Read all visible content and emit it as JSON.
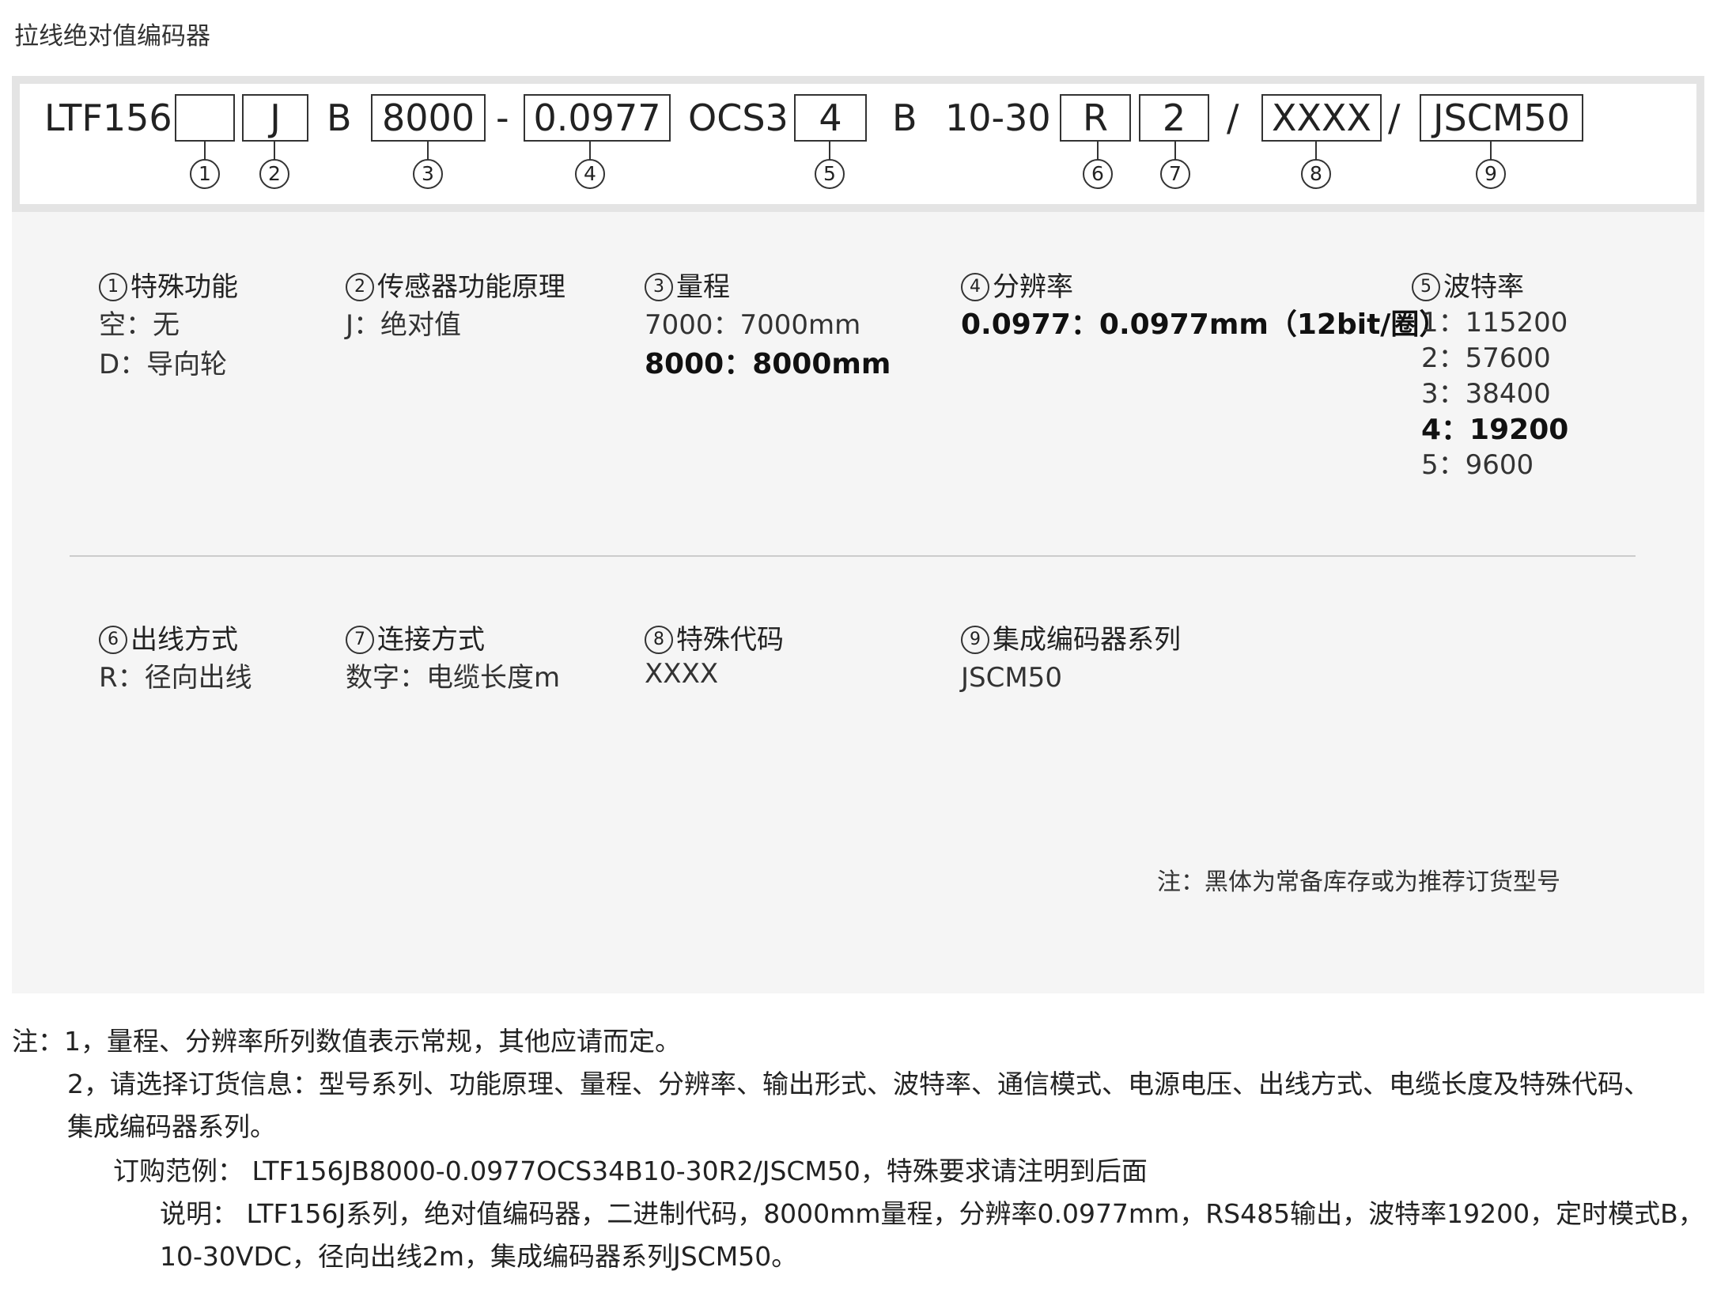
{
  "title": "拉线绝对值编码器",
  "code": {
    "prefix": "LTF156",
    "box1": "",
    "box2": "J",
    "sep_b1": "B",
    "box3": "8000",
    "dash": "-",
    "box4": "0.0977",
    "ocs": "OCS3",
    "box5": "4",
    "sep_b2": "B",
    "voltage": "10-30",
    "box6": "R",
    "box7": "2",
    "slash1": "/",
    "box8": "XXXX",
    "slash2": "/",
    "box9": "JSCM50"
  },
  "markers": [
    "1",
    "2",
    "3",
    "4",
    "5",
    "6",
    "7",
    "8",
    "9"
  ],
  "fields": [
    {
      "num": "1",
      "title": "特殊功能",
      "options": [
        {
          "text": "空：无",
          "bold": false
        },
        {
          "text": "D：导向轮",
          "bold": false
        }
      ]
    },
    {
      "num": "2",
      "title": "传感器功能原理",
      "options": [
        {
          "text": "J：绝对值",
          "bold": false
        }
      ]
    },
    {
      "num": "3",
      "title": "量程",
      "options": [
        {
          "text": "7000：7000mm",
          "bold": false
        },
        {
          "text": "8000：8000mm",
          "bold": true
        }
      ]
    },
    {
      "num": "4",
      "title": "分辨率",
      "options": [
        {
          "text": "0.0977：0.0977mm（12bit/圈）",
          "bold": true
        }
      ]
    },
    {
      "num": "5",
      "title": "波特率",
      "options": [
        {
          "text": "1：115200",
          "bold": false
        },
        {
          "text": "2：57600",
          "bold": false
        },
        {
          "text": "3：38400",
          "bold": false
        },
        {
          "text": "4：19200",
          "bold": true
        },
        {
          "text": "5：9600",
          "bold": false
        }
      ]
    },
    {
      "num": "6",
      "title": "出线方式",
      "options": [
        {
          "text": "R：径向出线",
          "bold": false
        }
      ]
    },
    {
      "num": "7",
      "title": "连接方式",
      "options": [
        {
          "text": "数字：电缆长度m",
          "bold": false
        }
      ]
    },
    {
      "num": "8",
      "title": "特殊代码",
      "options": [
        {
          "text": "XXXX",
          "bold": false
        }
      ]
    },
    {
      "num": "9",
      "title": "集成编码器系列",
      "options": [
        {
          "text": "JSCM50",
          "bold": false
        }
      ]
    }
  ],
  "bold_note": "注：黑体为常备库存或为推荐订货型号",
  "notes": {
    "line1": "注：1，量程、分辨率所列数值表示常规，其他应请而定。",
    "line2": "2，请选择订货信息：型号系列、功能原理、量程、分辨率、输出形式、波特率、通信模式、电源电压、出线方式、电缆长度及特殊代码、",
    "line3": "集成编码器系列。",
    "example": "订购范例： LTF156JB8000-0.0977OCS34B10-30R2/JSCM50，特殊要求请注明到后面",
    "explain1": "说明： LTF156J系列，绝对值编码器，二进制代码，8000mm量程，分辨率0.0977mm，RS485输出，波特率19200，定时模式B，",
    "explain2": "10-30VDC，径向出线2m，集成编码器系列JSCM50。"
  }
}
